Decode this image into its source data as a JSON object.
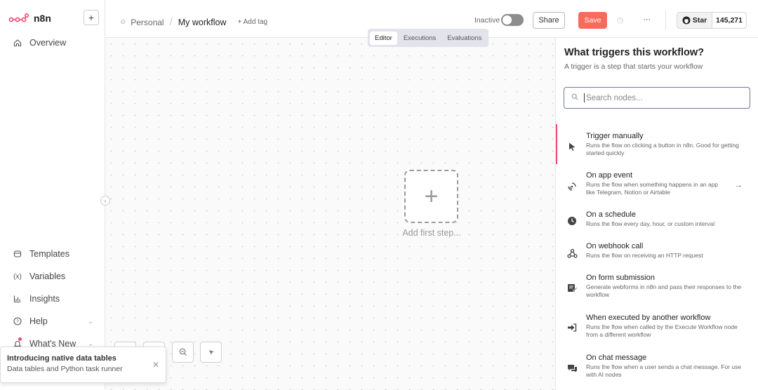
{
  "app": {
    "name": "n8n"
  },
  "sidebar": {
    "items": [
      {
        "label": "Overview",
        "icon": "home-icon"
      },
      {
        "label": "Templates",
        "icon": "templates-icon"
      },
      {
        "label": "Variables",
        "icon": "variables-icon"
      },
      {
        "label": "Insights",
        "icon": "insights-icon"
      },
      {
        "label": "Help",
        "icon": "help-icon"
      },
      {
        "label": "What's New",
        "icon": "bell-icon"
      }
    ]
  },
  "header": {
    "project": "Personal",
    "workflow_name": "My workflow",
    "add_tag": "+ Add tag",
    "status_label": "Inactive",
    "share_label": "Share",
    "save_label": "Save",
    "github_star_label": "Star",
    "github_star_count": "145,271"
  },
  "canvas": {
    "tabs": [
      "Editor",
      "Executions",
      "Evaluations"
    ],
    "active_tab": "Editor",
    "add_first_step": "Add first step..."
  },
  "toast": {
    "title": "Introducing native data tables",
    "text": "Data tables and Python task runner"
  },
  "panel": {
    "title": "What triggers this workflow?",
    "subtitle": "A trigger is a step that starts your workflow",
    "search_placeholder": "Search nodes...",
    "nodes": [
      {
        "title": "Trigger manually",
        "desc": "Runs the flow on clicking a button in n8n. Good for getting started quickly",
        "icon": "cursor-icon"
      },
      {
        "title": "On app event",
        "desc": "Runs the flow when something happens in an app like Telegram, Notion or Airtable",
        "icon": "satellite-icon"
      },
      {
        "title": "On a schedule",
        "desc": "Runs the flow every day, hour, or custom interval",
        "icon": "clock-icon"
      },
      {
        "title": "On webhook call",
        "desc": "Runs the flow on receiving an HTTP request",
        "icon": "webhook-icon"
      },
      {
        "title": "On form submission",
        "desc": "Generate webforms in n8n and pass their responses to the workflow",
        "icon": "form-icon"
      },
      {
        "title": "When executed by another workflow",
        "desc": "Runs the flow when called by the Execute Workflow node from a different workflow",
        "icon": "sign-in-icon"
      },
      {
        "title": "On chat message",
        "desc": "Runs the flow when a user sends a chat message. For use with AI nodes",
        "icon": "chat-icon"
      }
    ]
  }
}
